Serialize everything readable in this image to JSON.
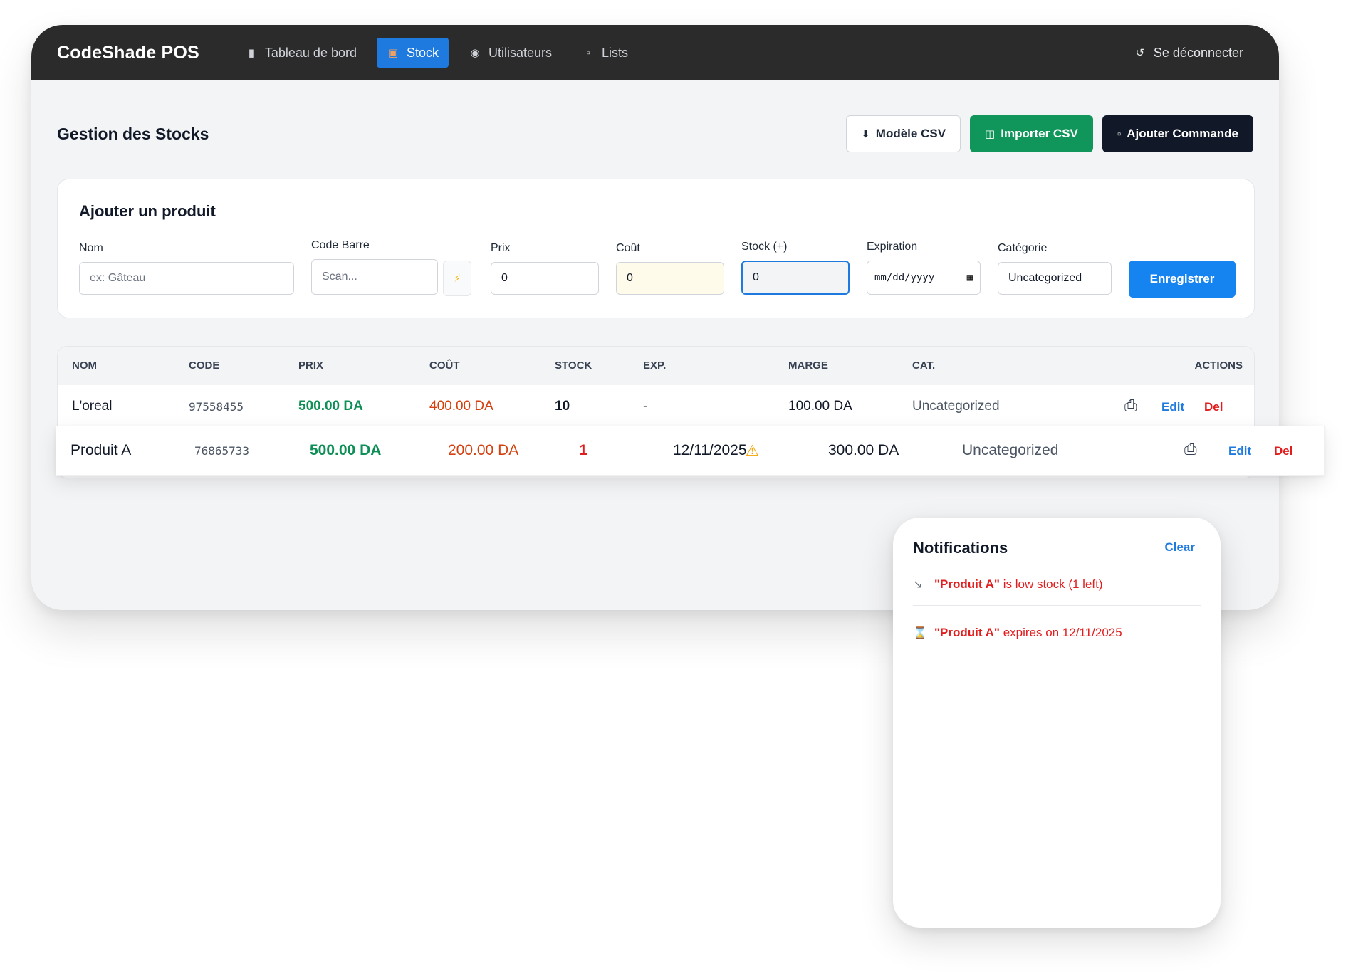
{
  "app": {
    "brand": "CodeShade POS"
  },
  "nav": {
    "items": [
      {
        "label": "Tableau de bord",
        "icon": "chart-icon"
      },
      {
        "label": "Stock",
        "icon": "box-icon",
        "active": true
      },
      {
        "label": "Utilisateurs",
        "icon": "users-icon"
      },
      {
        "label": "Lists",
        "icon": "document-icon"
      }
    ],
    "logout": "Se déconnecter"
  },
  "page": {
    "title": "Gestion des Stocks",
    "buttons": {
      "csv_template": "Modèle CSV",
      "import_csv": "Importer CSV",
      "add_order": "Ajouter Commande"
    }
  },
  "form": {
    "title": "Ajouter un produit",
    "nom": {
      "label": "Nom",
      "placeholder": "ex: Gâteau"
    },
    "code_barre": {
      "label": "Code Barre",
      "placeholder": "Scan..."
    },
    "prix": {
      "label": "Prix",
      "value": "0"
    },
    "cout": {
      "label": "Coût",
      "value": "0"
    },
    "stock": {
      "label": "Stock (+)",
      "value": "0"
    },
    "expiration": {
      "label": "Expiration",
      "value": "mm/dd/yyyy"
    },
    "categorie": {
      "label": "Catégorie",
      "value": "Uncategorized"
    },
    "save": "Enregistrer"
  },
  "table": {
    "headers": [
      "Nom",
      "Code",
      "Prix",
      "Coût",
      "Stock",
      "Exp.",
      "Marge",
      "Cat.",
      "Actions"
    ],
    "rows": [
      {
        "nom": "L'oreal",
        "code": "97558455",
        "prix": "500.00 DA",
        "cout": "400.00 DA",
        "stock": "10",
        "exp": "-",
        "marge": "100.00 DA",
        "cat": "Uncategorized",
        "edit": "Edit",
        "del": "Del"
      },
      {
        "nom": "Produit A",
        "code": "76865733",
        "prix": "500.00 DA",
        "cout": "200.00 DA",
        "stock": "1",
        "exp": "12/11/2025",
        "marge": "300.00 DA",
        "cat": "Uncategorized",
        "edit": "Edit",
        "del": "Del"
      }
    ]
  },
  "notifications": {
    "title": "Notifications",
    "clear": "Clear",
    "items": [
      {
        "name": "\"Produit A\"",
        "text": " is low stock (1 left)",
        "icon": "chart-down-icon"
      },
      {
        "name": "\"Produit A\"",
        "text": " expires on 12/11/2025",
        "icon": "hourglass-icon"
      }
    ]
  },
  "colors": {
    "accent": "#1f7ae0",
    "success": "#10965a",
    "danger": "#e11d1d",
    "navbar": "#2b2b2b"
  }
}
